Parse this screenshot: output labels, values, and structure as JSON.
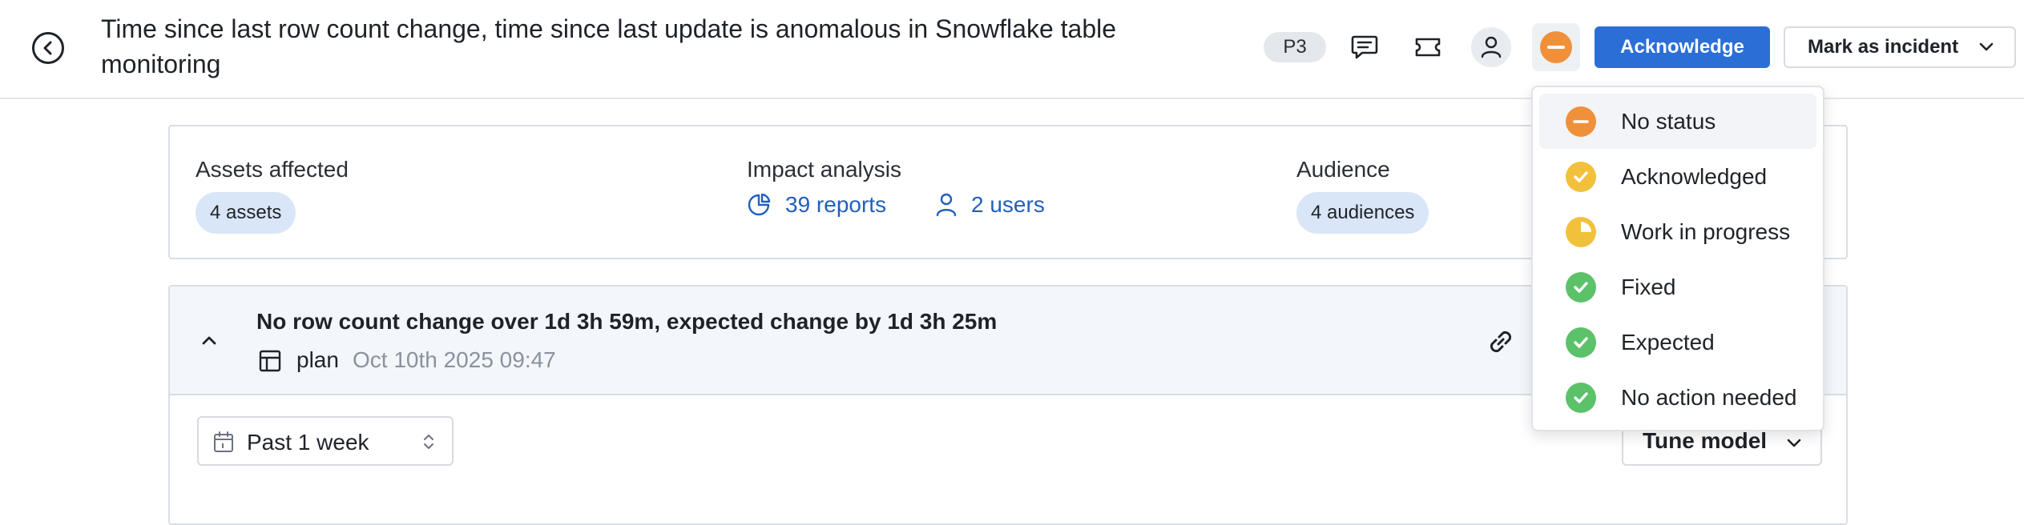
{
  "header": {
    "title": "Time since last row count change, time since last update is anomalous in Snowflake table monitoring",
    "priority": "P3",
    "acknowledge_label": "Acknowledge",
    "incident_label": "Mark as incident"
  },
  "summary": {
    "assets_label": "Assets affected",
    "assets_pill": "4 assets",
    "impact_label": "Impact analysis",
    "reports_link": "39 reports",
    "users_link": "2 users",
    "audience_label": "Audience",
    "audience_pill": "4 audiences"
  },
  "anomaly": {
    "title": "No row count change over 1d 3h 59m, expected change by 1d 3h 25m",
    "table_name": "plan",
    "timestamp": "Oct 10th 2025 09:47",
    "period": "Past 1 week",
    "tune_label": "Tune model"
  },
  "status_menu": {
    "items": [
      {
        "label": "No status",
        "icon": "minus-icon",
        "color": "#f0903a"
      },
      {
        "label": "Acknowledged",
        "icon": "check-icon",
        "color": "#f2c13c"
      },
      {
        "label": "Work in progress",
        "icon": "pie-progress-icon",
        "color": "#f2c13c"
      },
      {
        "label": "Fixed",
        "icon": "check-icon",
        "color": "#5cc26a"
      },
      {
        "label": "Expected",
        "icon": "check-icon",
        "color": "#5cc26a"
      },
      {
        "label": "No action needed",
        "icon": "check-icon",
        "color": "#5cc26a"
      }
    ]
  },
  "colors": {
    "primary": "#2b6fd6",
    "link": "#2060c0",
    "pill": "#d9e6f7"
  }
}
